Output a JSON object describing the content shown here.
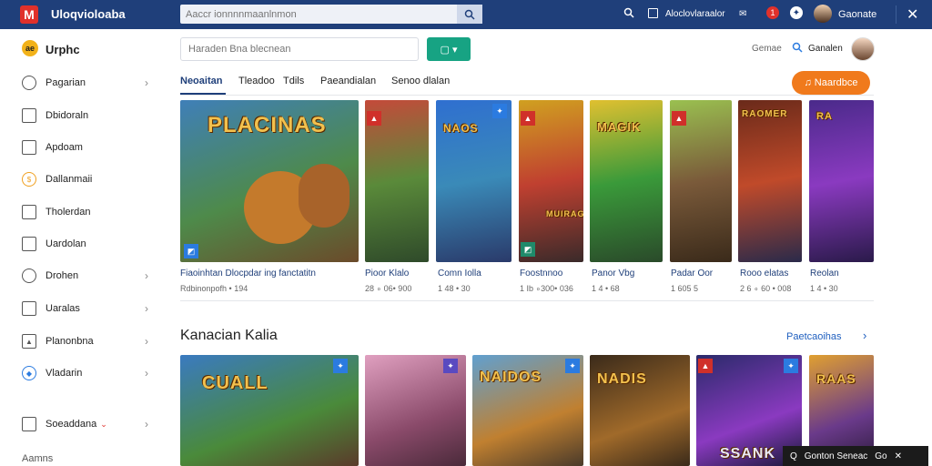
{
  "topbar": {
    "logo_letter": "M",
    "brand": "Uloqvioloaba",
    "search_placeholder": "Aaccr ionnnnmaanlnmon",
    "icons": [
      "search-icon",
      "news-icon",
      "chat-icon",
      "notification-icon",
      "help-icon"
    ],
    "news_label": "Aloclovlaraalor",
    "notification_count": "1",
    "username": "Gaonate"
  },
  "sidebar": {
    "logo_text": "ae",
    "brand": "Urphc",
    "items": [
      {
        "label": "Pagarian",
        "icon": "circle-icon",
        "chevron": true
      },
      {
        "label": "Dbidoraln",
        "icon": "box-icon",
        "chevron": false
      },
      {
        "label": "Apdoam",
        "icon": "folder-icon",
        "chevron": false
      },
      {
        "label": "Dallanmaii",
        "icon": "coin-icon",
        "chevron": false
      },
      {
        "label": "Tholerdan",
        "icon": "doc-icon",
        "chevron": false
      },
      {
        "label": "Uardolan",
        "icon": "list-icon",
        "chevron": false
      },
      {
        "label": "Drohen",
        "icon": "globe-icon",
        "chevron": true
      },
      {
        "label": "Uaralas",
        "icon": "grid-icon",
        "chevron": true
      },
      {
        "label": "Planonbna",
        "icon": "triangle-icon",
        "chevron": true
      },
      {
        "label": "Vladarin",
        "icon": "shield-icon",
        "chevron": true
      },
      {
        "label": "Soeaddana",
        "icon": "grid-icon",
        "chevron": true
      }
    ],
    "footer": "Aamns"
  },
  "toolbar": {
    "filter_placeholder": "Haraden Bna blecnean",
    "go_label": "▢ ▾",
    "user_label": "Gemae",
    "user_name": "Ganalen",
    "action_button": "♫ Naardbce"
  },
  "tabs": [
    "Neoaitan",
    "Tleadoo",
    "Tdils",
    "Paeandialan",
    "Senoo dlalan"
  ],
  "row1": {
    "cards": [
      {
        "title": "Fiaoinhtan Dlocpdar ing fanctatitn",
        "meta": "Rdbinonpofh • 194",
        "art": "PLACINAS"
      },
      {
        "title": "Pioor Klalo",
        "meta": "28 ∘ 06• 900",
        "art": ""
      },
      {
        "title": "Comn Iolla",
        "meta": "1 48 • 30",
        "art": "NAOS"
      },
      {
        "title": "Foostnnoo",
        "meta": "1 Ib ∘300• 036",
        "art": "MUIRAGO"
      },
      {
        "title": "Panor Vbg",
        "meta": "1 4 • 68",
        "art": "MAGIK"
      },
      {
        "title": "Padar Oor",
        "meta": "1 605 5",
        "art": ""
      },
      {
        "title": "Rooo elatas",
        "meta": "2 6 ∘ 60 • 008",
        "art": "RAOMER"
      },
      {
        "title": "Reolan",
        "meta": "1 4 • 30",
        "art": "RA"
      }
    ]
  },
  "section": {
    "title": "Kanacian Kalia",
    "link": "Paetcaoihas",
    "cards": [
      {
        "art": "CUALL"
      },
      {
        "art": ""
      },
      {
        "art": "NAIDOS"
      },
      {
        "art": "NADIS"
      },
      {
        "art": "SSANK"
      },
      {
        "art": "RAAS"
      }
    ]
  },
  "toast": {
    "text": "Gonton Seneac",
    "icon1": "Q",
    "icon2": "Go"
  }
}
